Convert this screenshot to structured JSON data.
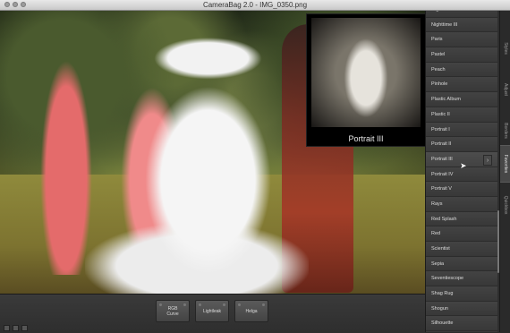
{
  "window": {
    "title": "CameraBag 2.0 - IMG_0350.png"
  },
  "preview": {
    "label": "Portrait III"
  },
  "filters": [
    "Nighttime II",
    "Nighttime III",
    "Paris",
    "Pastel",
    "Peach",
    "Pinhole",
    "Plastic Album",
    "Plastic II",
    "Portrait I",
    "Portrait II",
    "Portrait III",
    "Portrait IV",
    "Portrait V",
    "Rays",
    "Red Splash",
    "Red",
    "Scientist",
    "Sepia",
    "Seventiescope",
    "Shag Rug",
    "Shogun",
    "Silhouette"
  ],
  "selected_filter": "Portrait III",
  "tabs": [
    "Styles",
    "Adjust",
    "Borders",
    "Favorites",
    "Quickbox"
  ],
  "active_tab": "Favorites",
  "adjustments": [
    "RGB Curve",
    "Lightleak",
    "Helga"
  ],
  "icons": {
    "arrow": "chevron-right-icon",
    "cursor": "mouse-pointer-icon"
  }
}
